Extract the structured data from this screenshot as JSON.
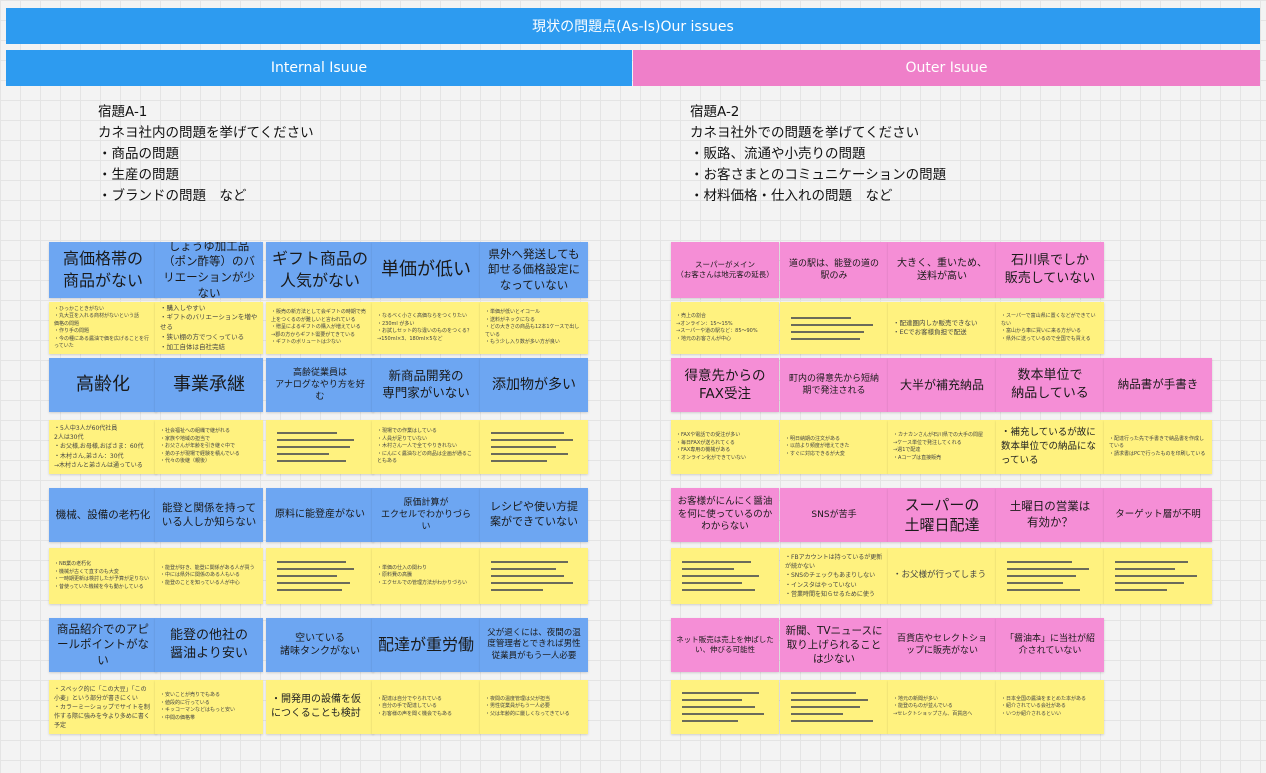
{
  "banner": "現状の問題点(As-Is)Our issues",
  "columns": {
    "internal": "Internal Isuue",
    "outer": "Outer Isuue"
  },
  "prompt_a1": {
    "title": "宿題A-1",
    "question": "カネヨ社内の問題を挙げてください",
    "items": [
      "・商品の問題",
      "・生産の問題",
      "・ブランドの問題　など"
    ]
  },
  "prompt_a2": {
    "title": "宿題A-2",
    "question": "カネヨ社外での問題を挙げてください",
    "items": [
      "・販路、流通や小売りの問題",
      "・お客さまとのコミュニケーションの問題",
      "・材料価格・仕入れの問題　など"
    ]
  },
  "internal": {
    "row1": [
      "高価格帯の\n商品がない",
      "しょうゆ加工品（ポン酢等）のバリエーションが少ない",
      "ギフト商品の\n人気がない",
      "単価が低い",
      "県外へ発送しても卸せる価格設定になっていない"
    ],
    "row1_notes": [
      "・ひっかこときがない\n・丸大豆を入れる商材がないという話\n価格の問題\n・作り手の問題\n・今の種にある醤油で価を広げることを行っていた",
      "・購入しやすい\n・ギフトのバリエーションを増やせる\n・狭い棚の方でつくっている\n・加工自体は自社完結",
      "・販売の新方法として会ギフトの時期で売上をつくるのが難しいと言われている\n・贈呈によるギフトの購入が増えている\n→郡の方からギフト需要がてきている\n・ギフトのボリュートは少ない",
      "・なるべく小さく高価ならをつくりたい\n・230ml が多い\n・お試しセット的な違いのものをつくる？\n→150ml×3、180ml×5など",
      "・単価が低いとイコール\n・送料がネックになる\n・どの大きさの商品も12本1ケースで出している\n・もう少し入り数が多い方が良い"
    ],
    "row2": [
      "高齢化",
      "事業承継",
      "高齢従業員は\nアナログなやり方を好む",
      "新商品開発の\n専門家がいない",
      "添加物が多い"
    ],
    "row2_notes": [
      "・5人中3人が60代社員\n2人は30代\n・お父様,お母様,おばさま：60代\n・木村さん,弟さん：30代\n→木村さんと弟さんは通っている",
      "・社会福祉への組織で継がれる\n・家族や地域の担当で\n・お父さんが年齢を引き継ぐ中で\n・弟の子が現場で経験を積んでいる\n・代々の後継（親後）",
      "",
      "・現場での作業はしている\n・人員が足りていない\n・木村さん一人で全てやりきれない\n・にんにく醤油などの商品は企画が通ることもある",
      ""
    ],
    "row3": [
      "機械、設備の老朽化",
      "能登と関係を持っている人しか知らない",
      "原料に能登産がない",
      "原価計算が\nエクセルでわかりづらい",
      "レシピや使い方提案ができていない"
    ],
    "row3_notes": [
      "・NB業の老朽化\n・機械が古くて直すのも大変\n・一時期更新は検討したが予算が足りない\n・昔使っていた機械を今も動かしている",
      "・能登が好き、能登に関係がある人が買う\n・中には県外に関係のある人もいる\n・能登のことを知っている人が中心",
      "",
      "・単価の仕入の関わり\n・原料費の高騰\n・エクセルでの管理方法がわかりづらい",
      ""
    ],
    "row4": [
      "商品紹介でのアピールポイントがない",
      "能登の他社の\n醤油より安い",
      "空いている\n諸味タンクがない",
      "配達が重労働",
      "父が退くには、夜間の温度管理者とできれば男性従業員がもう一人必要"
    ],
    "row4_notes": [
      "・スペック的に「この大豆」「この小麦」という部分が書きにくい\n・カラーミーショップでサイトを制作する際に強みを今より多めに書く予定",
      "・安いことが売りでもある\n・値段的に行っている\n・キッコーマンなどはもっと安い\n・中間の価格帯",
      "・開発用の設備を仮につくることも検討",
      "・配達は自分でやられている\n・自分の手で配達している\n・お客様の声を聞く機会でもある",
      "・夜間の温度管理は父が担当\n・男性従業員がもう一人必要\n・父は年齢的に厳しくなってきている"
    ]
  },
  "outer": {
    "row1": [
      "スーパーがメイン\n（お客さんは地元客の延長）",
      "道の駅は、能登の道の駅のみ",
      "大きく、重いため、送料が高い",
      "石川県でしか\n販売していない"
    ],
    "row1_notes": [
      "・売上の割合\n→オンライン：15〜15%\n→スーパーや道の駅など：85〜90%\n・地元のお客さんが中心",
      "",
      "・配達圏内しか販売できない\n・ECでお客様負担で配送",
      "・スーパーで富山県に置くなどができていない\n・富山から車に買いに来る方がいる\n・県外に送っているので全国でも買える"
    ],
    "row2": [
      "得意先からのFAX受注",
      "町内の得意先から短納期で発注される",
      "大半が補充納品",
      "数本単位で\n納品している",
      "納品書が手書き"
    ],
    "row2_notes": [
      "・FAXや電話での受注が多い\n・毎日FAXが送られてくる\n・FAX専用の機械がある\n・オンライン化ができていない",
      "・明日納期の注文がある\n・以前より頻度が増えてきた\n・すぐに対応できるが大変",
      "・カナカンさんが石川県での大手の問屋\n→ケース単位で発注してくれる\n→週1で配達\n・Aコープは直接販売",
      "・補充しているが故に数本単位での納品になっている",
      "・配達行った先で手書きで納品書を作成している\n・請求書はPCで行ったものを印刷している"
    ],
    "row3": [
      "お客様がにんにく醤油を何に使っているのかわからない",
      "SNSが苦手",
      "スーパーの\n土曜日配達",
      "土曜日の営業は\n有効か？",
      "ターゲット層が不明"
    ],
    "row3_notes": [
      "",
      "・FBアカウントは持っているが更新が続かない\n・SNSのチェックもあまりしない\n・インスタはやっていない\n・営業時間を知らせるために使う",
      "・お父様が行ってしまう",
      "",
      ""
    ],
    "row4": [
      "ネット販売は売上を伸ばしたい、伸びる可能性",
      "新聞、TVニュースに取り上げられることは少ない",
      "百貨店やセレクトショップに販売がない",
      "「醤油本」に当社が紹介されていない"
    ],
    "row4_notes": [
      "",
      "",
      "・地元の新聞が多い\n・能登のものが並んでいる\n→セレクトショップさん、百貨店へ",
      "・日本全国の醤油をまとめた本がある\n・紹介されている会社がある\n・いつか紹介されるといい"
    ]
  }
}
